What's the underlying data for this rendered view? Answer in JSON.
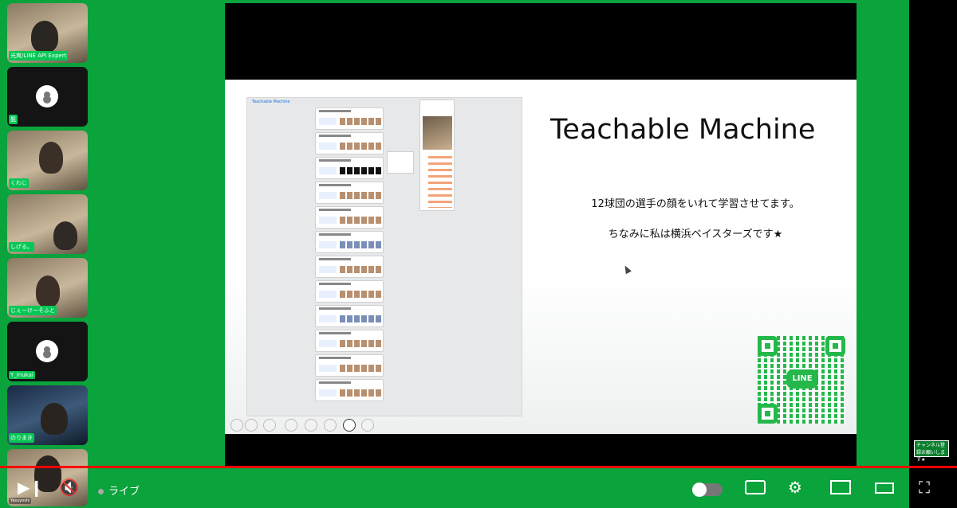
{
  "participants": [
    {
      "name": "光爽/LINE API Expert",
      "camera": true
    },
    {
      "name": "髭",
      "camera": false
    },
    {
      "name": "くわじ",
      "camera": true
    },
    {
      "name": "しげる。",
      "camera": true
    },
    {
      "name": "じぇーけーそふと",
      "camera": true
    },
    {
      "name": "Y_Inukai",
      "camera": false
    },
    {
      "name": "のりまき",
      "camera": true
    },
    {
      "name": "Yasuyoshi",
      "camera": true
    }
  ],
  "slide": {
    "screenshot_title": "Teachable Machine",
    "title": "Teachable Machine",
    "line1": "12球団の選手の顔をいれて学習させてます。",
    "line2": "ちなみに私は横浜ベイスターズです★",
    "qr_logo": "LINE"
  },
  "player": {
    "live_label": "ライブ",
    "channel_badge": "チャンネル登録お願いします★",
    "icons": [
      "play-next-icon",
      "mute-icon",
      "autoplay-toggle",
      "subtitles-icon",
      "settings-icon",
      "miniplayer-icon",
      "theater-icon",
      "fullscreen-icon"
    ]
  }
}
